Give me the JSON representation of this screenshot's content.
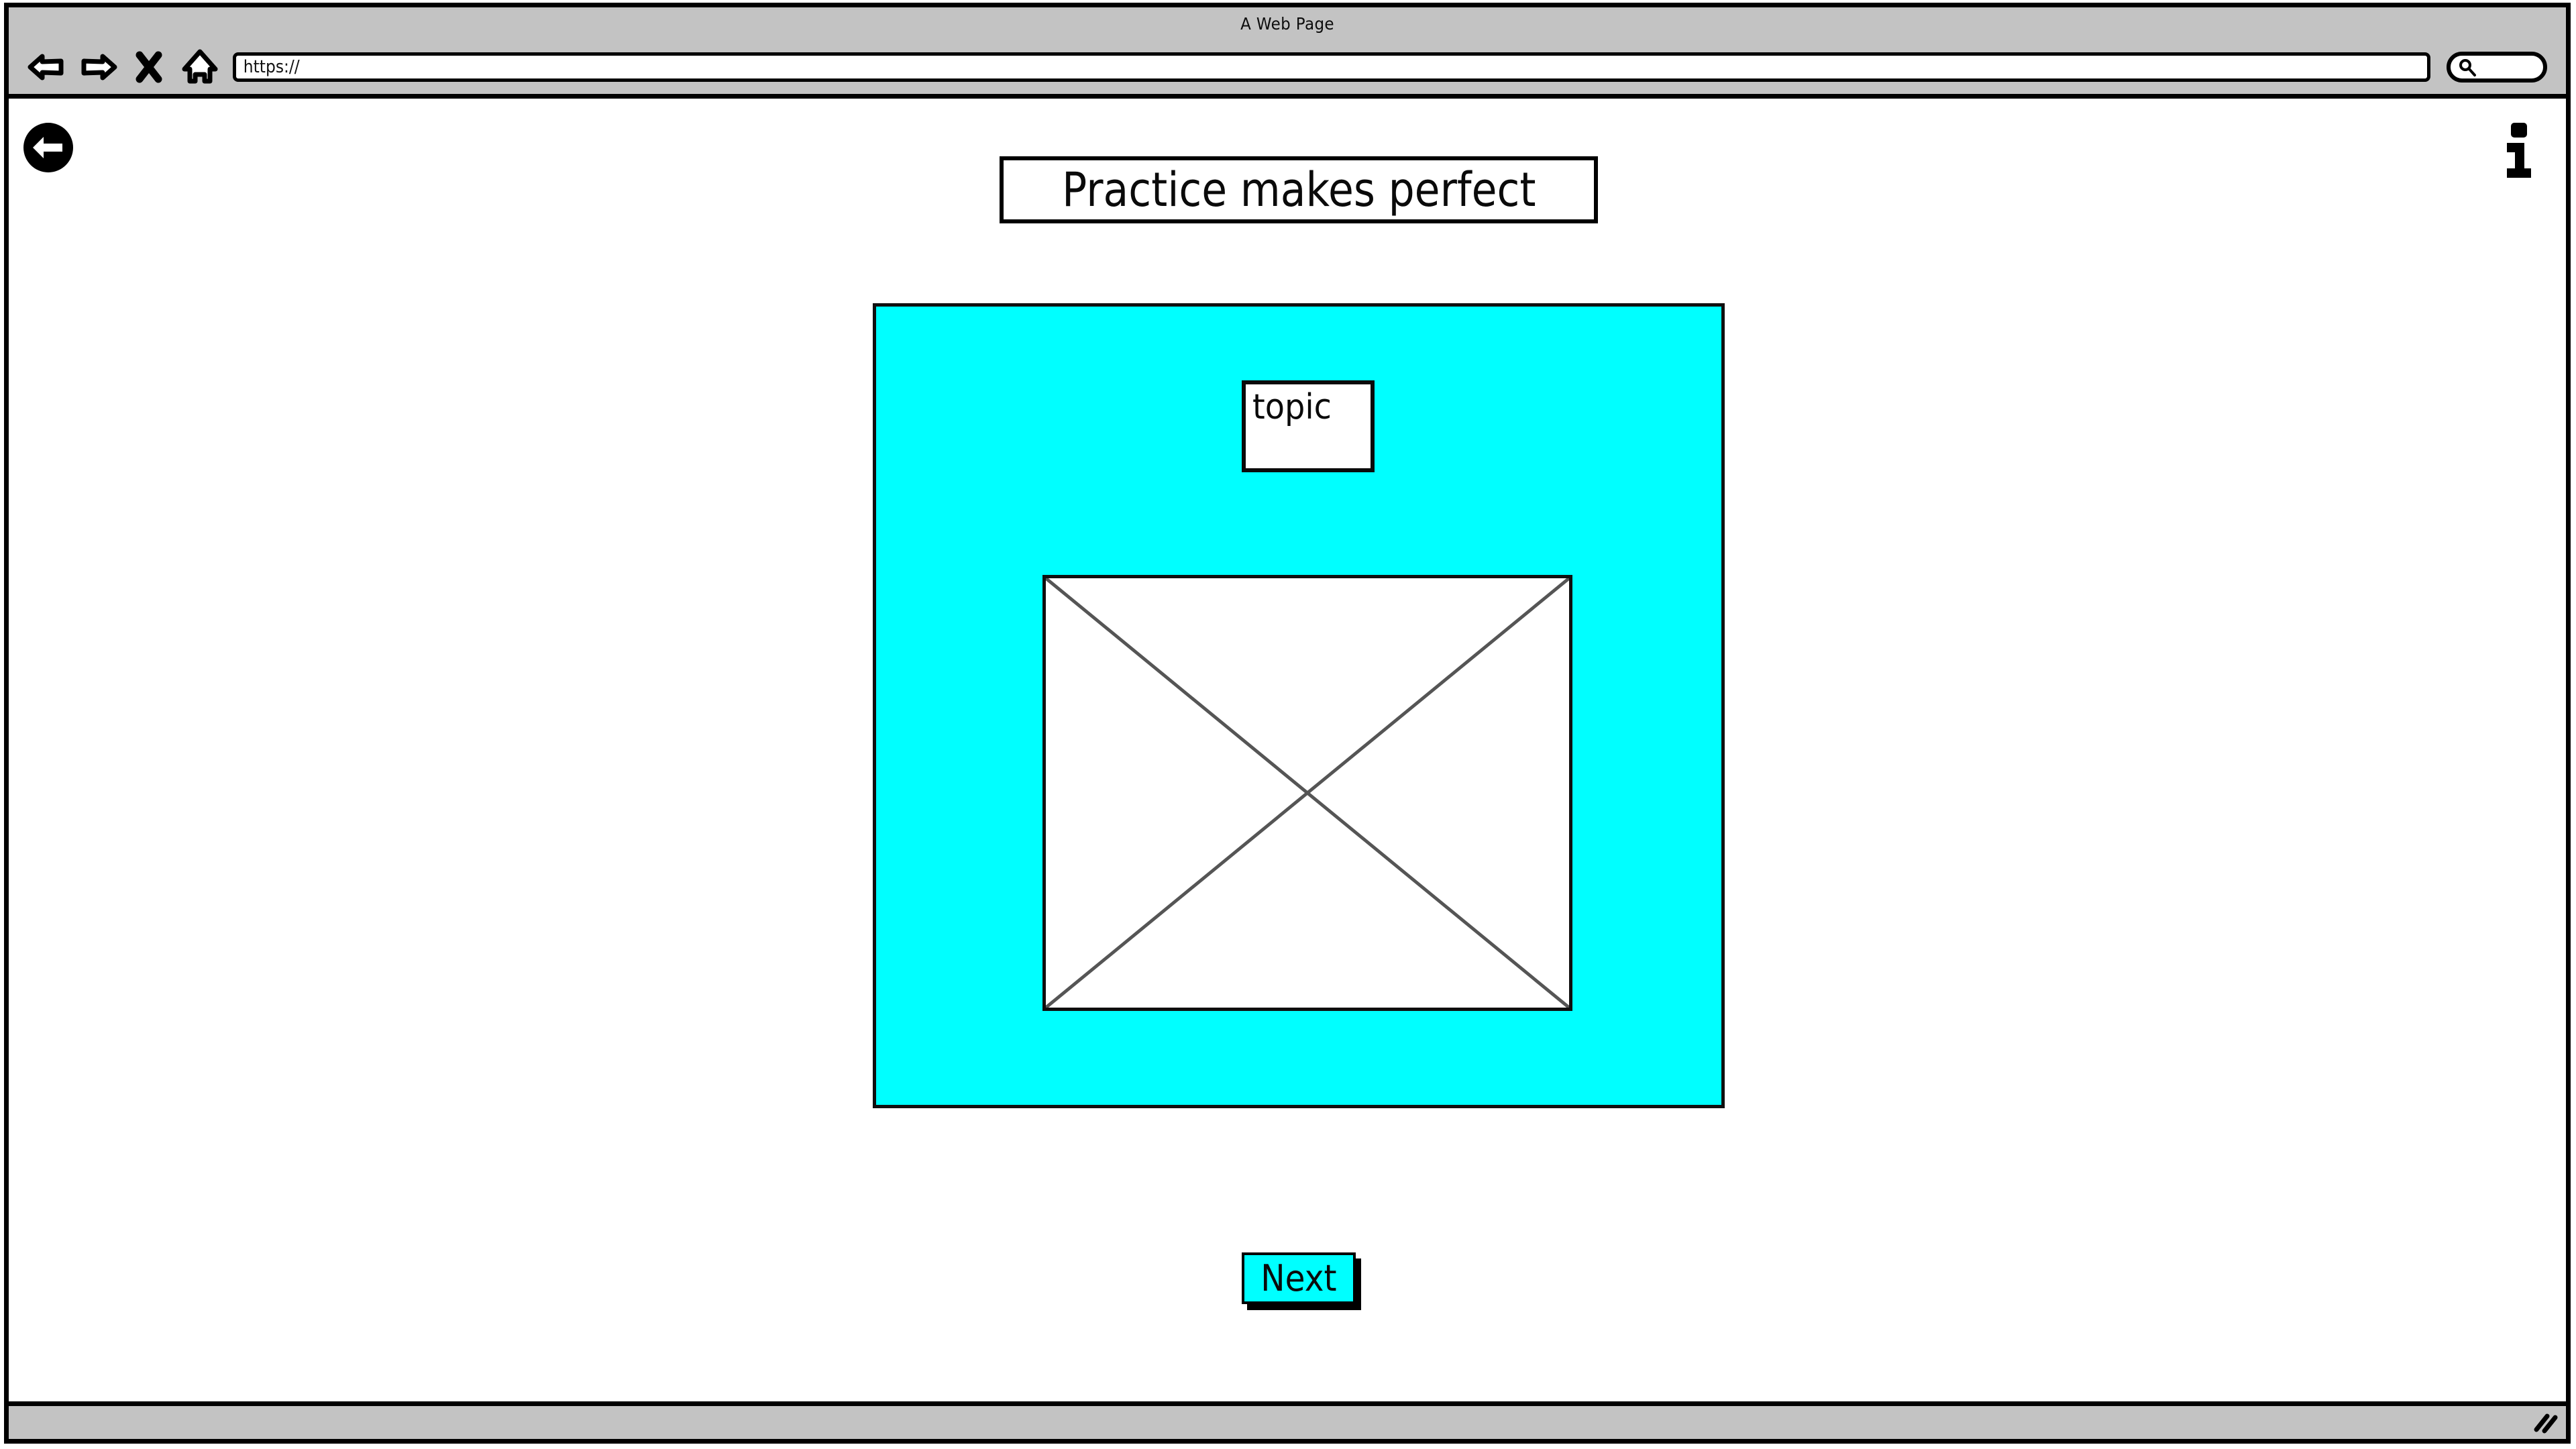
{
  "window": {
    "title": "A Web Page"
  },
  "toolbar": {
    "back_icon": "back-arrow-icon",
    "forward_icon": "forward-arrow-icon",
    "stop_icon": "stop-x-icon",
    "home_icon": "home-icon",
    "url_value": "https://",
    "url_placeholder": "https://",
    "search_value": "",
    "search_placeholder": "",
    "search_icon": "search-icon"
  },
  "page": {
    "back_button_icon": "circle-back-arrow-icon",
    "info_icon": "info-icon",
    "heading": "Practice makes perfect",
    "panel": {
      "background_color": "#00FFFF",
      "topic_label": "topic",
      "image_placeholder_icon": "image-placeholder-icon"
    },
    "next_label": "Next"
  },
  "status": {
    "resize_grip_icon": "resize-grip-icon"
  },
  "colors": {
    "accent": "#00FFFF",
    "chrome": "#C3C3C3",
    "outline": "#000000",
    "page_background": "#FFFFFF"
  }
}
